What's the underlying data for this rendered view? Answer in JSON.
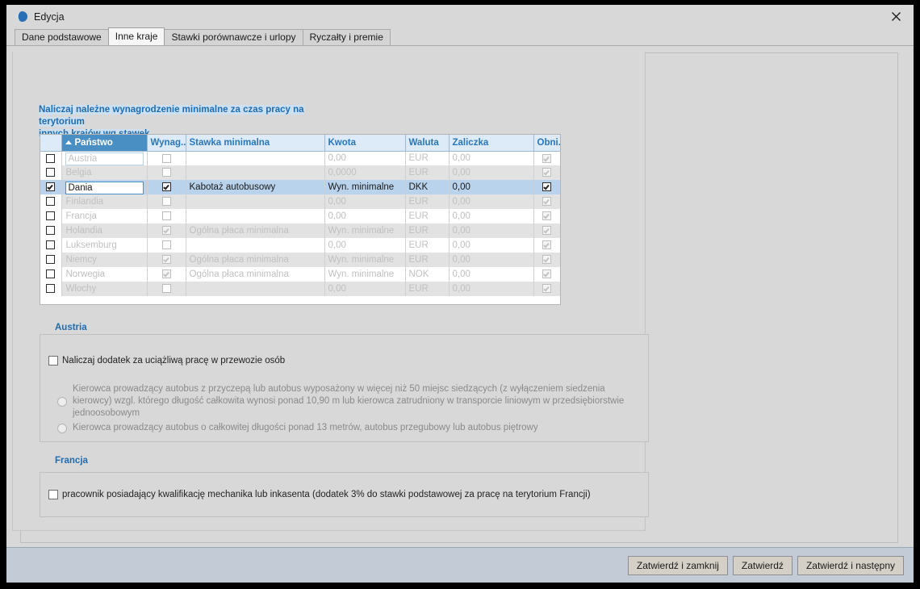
{
  "window": {
    "title": "Edycja",
    "icon": "app-moon-icon",
    "close_label": "✕"
  },
  "tabs": [
    {
      "label": "Dane podstawowe",
      "active": false
    },
    {
      "label": "Inne kraje",
      "active": true
    },
    {
      "label": "Stawki porównawcze i urlopy",
      "active": false
    },
    {
      "label": "Ryczałty i premie",
      "active": false
    }
  ],
  "grid_heading": {
    "line1": "Naliczaj należne wynagrodzenie minimalne za czas pracy na terytorium",
    "line2": "innych krajów wg stawek"
  },
  "grid": {
    "columns": [
      {
        "key": "check",
        "label": ""
      },
      {
        "key": "panstwo",
        "label": "Państwo",
        "sorted": true,
        "sort_dir": "asc"
      },
      {
        "key": "wynag",
        "label": "Wynag..."
      },
      {
        "key": "stawka",
        "label": "Stawka minimalna"
      },
      {
        "key": "kwota",
        "label": "Kwota"
      },
      {
        "key": "waluta",
        "label": "Waluta"
      },
      {
        "key": "zaliczka",
        "label": "Zaliczka"
      },
      {
        "key": "obni",
        "label": "Obni..."
      }
    ],
    "rows": [
      {
        "check": false,
        "panstwo": "Austria",
        "wynag": false,
        "stawka": "",
        "kwota": "0,00",
        "waluta": "EUR",
        "zaliczka": "0,00",
        "obni": true,
        "selected": false,
        "current": true
      },
      {
        "check": false,
        "panstwo": "Belgia",
        "wynag": false,
        "stawka": "",
        "kwota": "0,0000",
        "waluta": "EUR",
        "zaliczka": "0,00",
        "obni": true,
        "selected": false,
        "current": false
      },
      {
        "check": true,
        "panstwo": "Dania",
        "wynag": true,
        "stawka": "Kabotaż autobusowy",
        "kwota": "Wyn. minimalne",
        "waluta": "DKK",
        "zaliczka": "0,00",
        "obni": true,
        "selected": true,
        "current": false
      },
      {
        "check": false,
        "panstwo": "Finlandia",
        "wynag": false,
        "stawka": "",
        "kwota": "0,00",
        "waluta": "EUR",
        "zaliczka": "0,00",
        "obni": true,
        "selected": false,
        "current": false
      },
      {
        "check": false,
        "panstwo": "Francja",
        "wynag": false,
        "stawka": "",
        "kwota": "0,00",
        "waluta": "EUR",
        "zaliczka": "0,00",
        "obni": true,
        "selected": false,
        "current": false
      },
      {
        "check": false,
        "panstwo": "Holandia",
        "wynag": true,
        "stawka": "Ogólna płaca minimalna",
        "kwota": "Wyn. minimalne",
        "waluta": "EUR",
        "zaliczka": "0,00",
        "obni": true,
        "selected": false,
        "current": false
      },
      {
        "check": false,
        "panstwo": "Luksemburg",
        "wynag": false,
        "stawka": "",
        "kwota": "0,00",
        "waluta": "EUR",
        "zaliczka": "0,00",
        "obni": true,
        "selected": false,
        "current": false
      },
      {
        "check": false,
        "panstwo": "Niemcy",
        "wynag": true,
        "stawka": "Ogólna płaca minimalna",
        "kwota": "Wyn. minimalne",
        "waluta": "EUR",
        "zaliczka": "0,00",
        "obni": true,
        "selected": false,
        "current": false
      },
      {
        "check": false,
        "panstwo": "Norwegia",
        "wynag": true,
        "stawka": "Ogólna płaca minimalna",
        "kwota": "Wyn. minimalne",
        "waluta": "NOK",
        "zaliczka": "0,00",
        "obni": true,
        "selected": false,
        "current": false
      },
      {
        "check": false,
        "panstwo": "Włochy",
        "wynag": false,
        "stawka": "",
        "kwota": "0,00",
        "waluta": "EUR",
        "zaliczka": "0,00",
        "obni": true,
        "selected": false,
        "current": false
      }
    ]
  },
  "austria": {
    "title": "Austria",
    "checkbox_label": "Naliczaj dodatek za uciążliwą pracę w przewozie osób",
    "checkbox_checked": false,
    "option1": "Kierowca prowadzący autobus z przyczepą lub autobus wyposażony w więcej niż 50 miejsc siedzących (z wyłączeniem siedzenia kierowcy) wzgl. którego długość całkowita wynosi ponad 10,90 m lub kierowca zatrudniony w transporcie liniowym w przedsiębiorstwie jednoosobowym",
    "option2": "Kierowca prowadzący autobus o całkowitej długości ponad 13 metrów, autobus przegubowy lub autobus piętrowy",
    "option_selected": ""
  },
  "francja": {
    "title": "Francja",
    "checkbox_label": "pracownik posiadający kwalifikację mechanika lub inkasenta (dodatek 3% do stawki podstawowej za pracę na terytorium Francji)",
    "checkbox_checked": false
  },
  "footer": {
    "buttons": [
      {
        "label": "Zatwierdź i zamknij"
      },
      {
        "label": "Zatwierdź"
      },
      {
        "label": "Zatwierdź i następny"
      }
    ]
  },
  "colors": {
    "accent_blue": "#2a76ba",
    "header_blue": "#dcebf7",
    "sorted_col": "#4a8fc4",
    "selection_row": "#b9d3ec",
    "window_bg": "#d8d8d8",
    "footer_bg": "#c3ccd6"
  }
}
